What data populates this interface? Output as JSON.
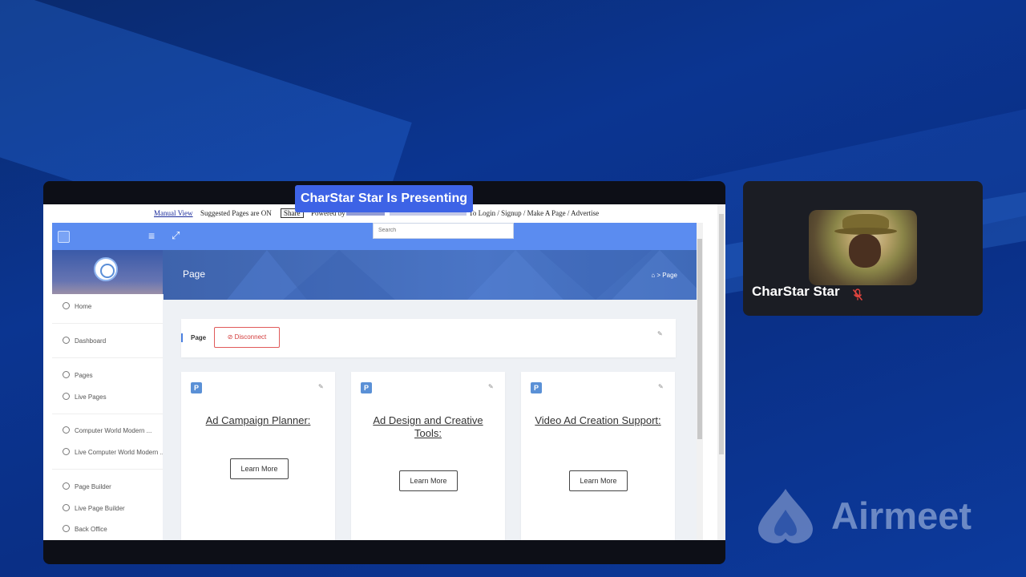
{
  "presenting_label": "CharStar Star Is Presenting",
  "shared_page": {
    "topbar": {
      "manual_view": "Manual View",
      "suggested": "Suggested Pages are ON",
      "share": "Share",
      "powered_by": "Powered by",
      "links": "To Login / Signup / Make A Page / Advertise"
    },
    "nav": {
      "menu_icon": "hamburger-icon",
      "expand_icon": "expand-icon",
      "search_placeholder": "Search"
    },
    "banner": {
      "title": "Page",
      "breadcrumb": "⌂ > Page"
    },
    "sidebar": {
      "items": [
        {
          "label": "Home",
          "icon": "home-icon"
        },
        {
          "label": "Dashboard",
          "icon": "dashboard-icon"
        },
        {
          "label": "Pages",
          "icon": "pages-icon"
        },
        {
          "label": "Live Pages",
          "icon": "pages-icon"
        },
        {
          "label": "Computer World Modern ...",
          "icon": "pages-icon"
        },
        {
          "label": "Live Computer World Modern ...",
          "icon": "pages-icon"
        },
        {
          "label": "Page Builder",
          "icon": "builder-icon"
        },
        {
          "label": "Live Page Builder",
          "icon": "builder-icon"
        },
        {
          "label": "Back Office",
          "icon": "office-icon"
        }
      ]
    },
    "page_bar": {
      "label": "Page",
      "disconnect": "⊘ Disconnect"
    },
    "cards": [
      {
        "badge": "P",
        "title": "Ad Campaign Planner:",
        "button": "Learn More"
      },
      {
        "badge": "P",
        "title": "Ad Design and Creative Tools:",
        "button": "Learn More"
      },
      {
        "badge": "P",
        "title": "Video Ad Creation Support:",
        "button": "Learn More"
      }
    ]
  },
  "participant": {
    "name": "CharStar Star",
    "mic_state": "muted"
  },
  "brand": "Airmeet",
  "colors": {
    "presenting_badge": "#3d63e6",
    "nav_blue": "#5b8cf0",
    "disconnect_red": "#d23b3b",
    "background_navy": "#0b3591"
  }
}
